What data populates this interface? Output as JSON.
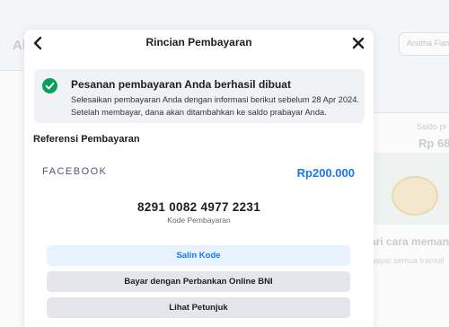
{
  "background": {
    "left_title": "Al",
    "search_placeholder": "Arsitha Fiam",
    "saldo_label": "Saldo pr",
    "saldo_value": "Rp 68",
    "cara_text": "ari cara memant",
    "riwayat_text": "wayat semua transal"
  },
  "modal": {
    "title": "Rincian Pembayaran",
    "alert": {
      "title": "Pesanan pembayaran Anda berhasil dibuat",
      "body": "Selesaikan pembayaran Anda dengan informasi berikut sebelum 28 Apr 2024. Setelah membayar, dana akan ditambahkan ke saldo prabayar Anda."
    },
    "section_title": "Referensi Pembayaran",
    "merchant": "FACEBOOK",
    "amount": "Rp200.000",
    "payment_code": "8291 0082 4977 2231",
    "payment_code_label": "Kode Pembayaran",
    "buttons": {
      "copy_code": "Salin Kode",
      "pay_bank": "Bayar dengan Perbankan Online BNI",
      "instructions": "Lihat Petunjuk"
    }
  },
  "colors": {
    "accent": "#1877f2",
    "success": "#0aa05a",
    "merchant_text": "#4a5576"
  },
  "icons": {
    "back": "chevron-left-icon",
    "close": "close-icon",
    "success": "check-circle-icon"
  }
}
